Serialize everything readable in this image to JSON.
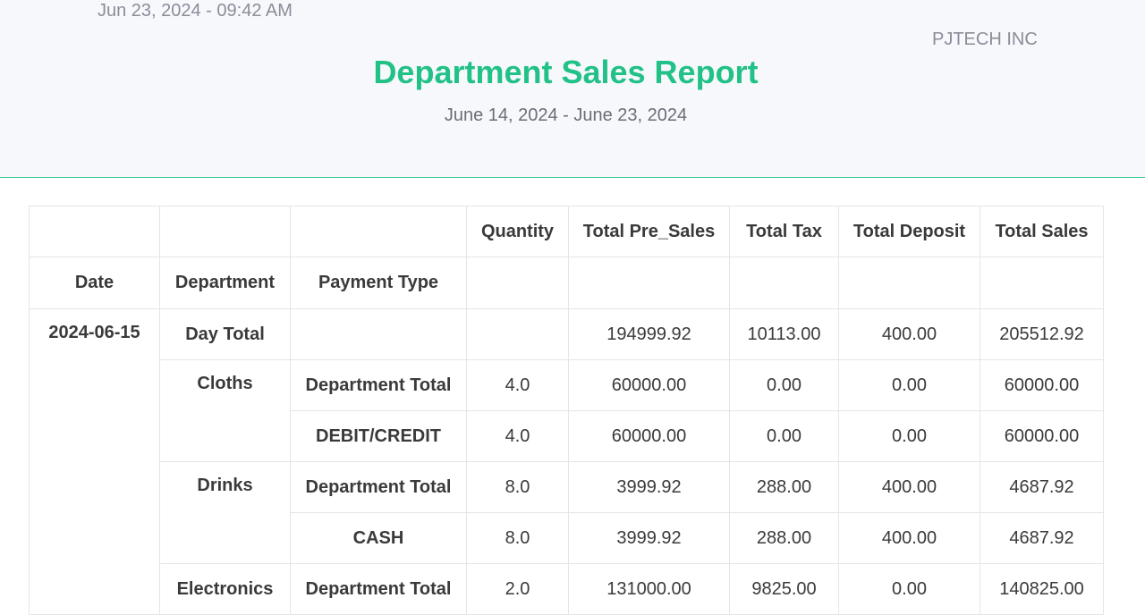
{
  "report": {
    "timestamp": "Jun 23, 2024 - 09:42 AM",
    "company": "PJTECH INC",
    "title": "Department Sales Report",
    "date_range": "June 14, 2024 - June 23, 2024"
  },
  "table": {
    "headers": {
      "date": "Date",
      "department": "Department",
      "payment_type": "Payment Type",
      "quantity": "Quantity",
      "total_pre_sales": "Total Pre_Sales",
      "total_tax": "Total Tax",
      "total_deposit": "Total Deposit",
      "total_sales": "Total Sales"
    },
    "day": {
      "date": "2024-06-15",
      "label": "Day Total",
      "payment_type": "",
      "quantity": "",
      "pre_sales": "194999.92",
      "tax": "10113.00",
      "deposit": "400.00",
      "sales": "205512.92"
    },
    "rows": [
      {
        "department": "Cloths",
        "payment_type": "Department Total",
        "quantity": "4.0",
        "pre_sales": "60000.00",
        "tax": "0.00",
        "deposit": "0.00",
        "sales": "60000.00"
      },
      {
        "department": "",
        "payment_type": "DEBIT/CREDIT",
        "quantity": "4.0",
        "pre_sales": "60000.00",
        "tax": "0.00",
        "deposit": "0.00",
        "sales": "60000.00"
      },
      {
        "department": "Drinks",
        "payment_type": "Department Total",
        "quantity": "8.0",
        "pre_sales": "3999.92",
        "tax": "288.00",
        "deposit": "400.00",
        "sales": "4687.92"
      },
      {
        "department": "",
        "payment_type": "CASH",
        "quantity": "8.0",
        "pre_sales": "3999.92",
        "tax": "288.00",
        "deposit": "400.00",
        "sales": "4687.92"
      },
      {
        "department": "Electronics",
        "payment_type": "Department Total",
        "quantity": "2.0",
        "pre_sales": "131000.00",
        "tax": "9825.00",
        "deposit": "0.00",
        "sales": "140825.00"
      }
    ]
  }
}
